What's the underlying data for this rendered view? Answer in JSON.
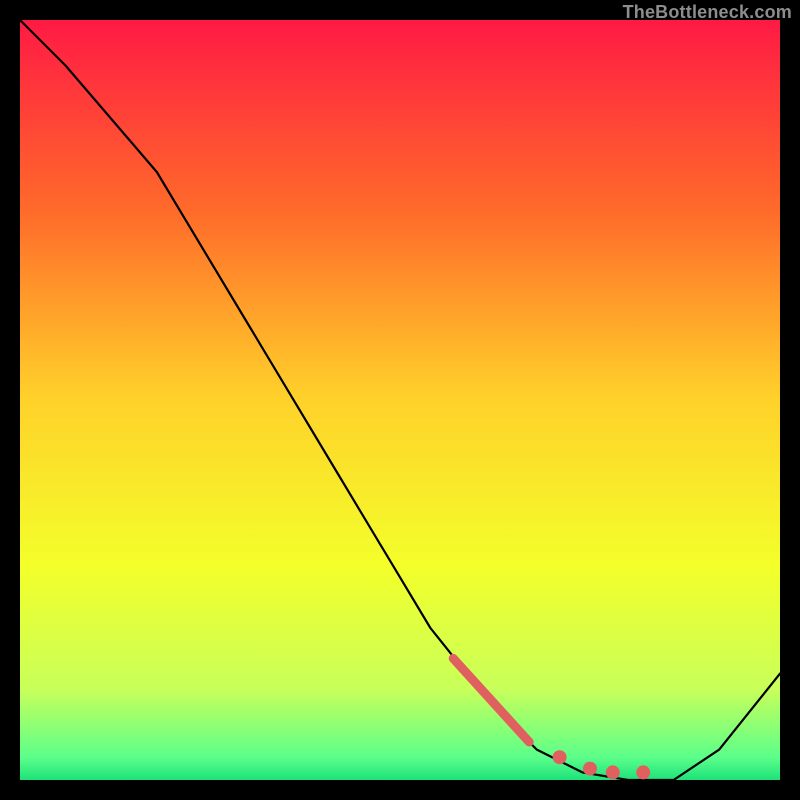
{
  "watermark": "TheBottleneck.com",
  "chart_data": {
    "type": "line",
    "title": "",
    "xlabel": "",
    "ylabel": "",
    "xlim": [
      0,
      100
    ],
    "ylim": [
      0,
      100
    ],
    "grid": false,
    "legend": false,
    "background_gradient": {
      "direction": "vertical",
      "stops": [
        {
          "pos": 0.0,
          "color": "#ff1a44"
        },
        {
          "pos": 0.25,
          "color": "#ff6a2a"
        },
        {
          "pos": 0.5,
          "color": "#ffd22a"
        },
        {
          "pos": 0.72,
          "color": "#f3ff2a"
        },
        {
          "pos": 0.88,
          "color": "#c8ff5a"
        },
        {
          "pos": 0.97,
          "color": "#5cff8a"
        },
        {
          "pos": 1.0,
          "color": "#1de27a"
        }
      ]
    },
    "series": [
      {
        "name": "bottleneck-curve",
        "type": "line",
        "color": "#000000",
        "x": [
          0,
          6,
          18,
          30,
          42,
          54,
          62,
          68,
          74,
          80,
          86,
          92,
          100
        ],
        "y": [
          100,
          94,
          80,
          60,
          40,
          20,
          10,
          4,
          1,
          0,
          0,
          4,
          14
        ]
      },
      {
        "name": "highlight-descent",
        "type": "line",
        "color": "#e06060",
        "stroke_width": 9,
        "x": [
          57,
          67
        ],
        "y": [
          16,
          5
        ]
      },
      {
        "name": "highlight-dots",
        "type": "scatter",
        "color": "#e06060",
        "marker_size": 7,
        "x": [
          71,
          75,
          78,
          82
        ],
        "y": [
          3,
          1.5,
          1,
          1
        ]
      }
    ]
  }
}
